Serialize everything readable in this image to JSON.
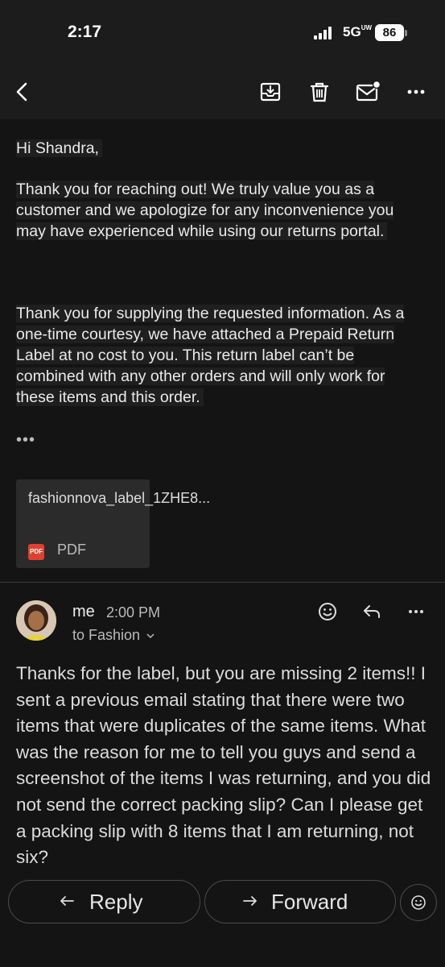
{
  "status_bar": {
    "time": "2:17",
    "network": "5G",
    "network_suffix": "UW",
    "battery": "86"
  },
  "toolbar": {
    "back_icon": "chevron-left-icon",
    "archive_icon": "archive-icon",
    "delete_icon": "trash-icon",
    "mark_unread_icon": "mail-unread-icon",
    "more_icon": "more-horizontal-icon"
  },
  "message": {
    "greeting": "Hi Shandra,",
    "paragraph1": "Thank you for reaching out! We truly value you as a customer and we apologize for any inconvenience you may have experienced while using our returns portal.",
    "paragraph2": "Thank you for supplying the requested information. As a one-time courtesy, we have attached a Prepaid Return Label at no cost to you. This return label can’t be combined with any other orders and will only work for these items and this order.",
    "trimmed_indicator": "•••",
    "attachment": {
      "name": "fashionnova_label_1ZHE8...",
      "type": "PDF",
      "icon_text": "PDF"
    }
  },
  "reply": {
    "sender": "me",
    "time": "2:00 PM",
    "recipient": "to Fashion",
    "body": "Thanks for the label, but you are missing 2 items!!  I sent a previous email stating that there were two items that were duplicates of the same items.  What was the reason for me to tell you guys and send a screenshot of the items I was returning, and you did not send the correct packing slip?  Can I please get a packing slip with 8 items that I am returning, not six?"
  },
  "actions": {
    "reply_label": "Reply",
    "forward_label": "Forward"
  },
  "colors": {
    "background": "#141414",
    "toolbar": "#1c1c1c",
    "pdf_red": "#e0402f"
  }
}
